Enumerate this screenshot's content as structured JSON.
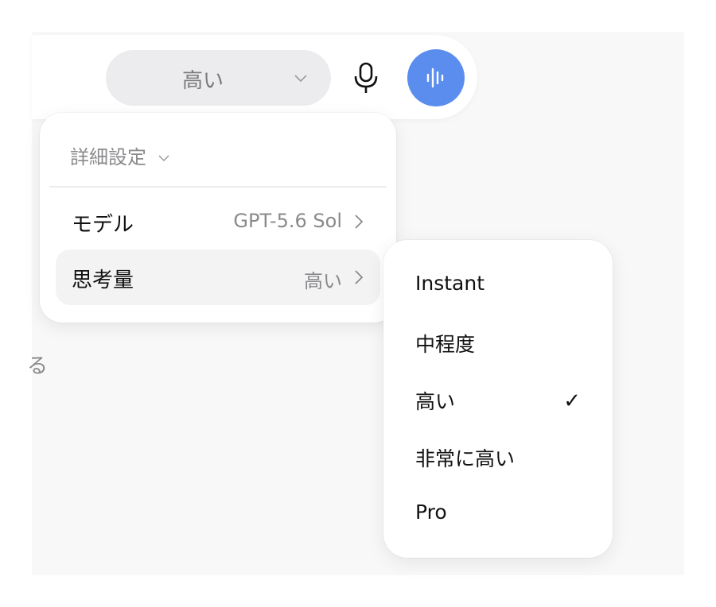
{
  "composer": {
    "effort_selected": "高い",
    "effort_icon": "chevron-down-icon",
    "mic_icon": "microphone-icon",
    "voice_icon": "voice-waveform-icon",
    "voice_button_color": "#5b8def"
  },
  "background_text": "る",
  "settings_menu": {
    "header": "詳細設定",
    "rows": [
      {
        "label": "モデル",
        "value": "GPT-5.6 Sol"
      },
      {
        "label": "思考量",
        "value": "高い"
      }
    ]
  },
  "effort_menu": {
    "items": [
      {
        "label": "Instant",
        "checked": false
      },
      {
        "label": "中程度",
        "checked": false
      },
      {
        "label": "高い",
        "checked": true
      },
      {
        "label": "非常に高い",
        "checked": false
      },
      {
        "label": "Pro",
        "checked": false
      }
    ],
    "check_glyph": "✓"
  }
}
